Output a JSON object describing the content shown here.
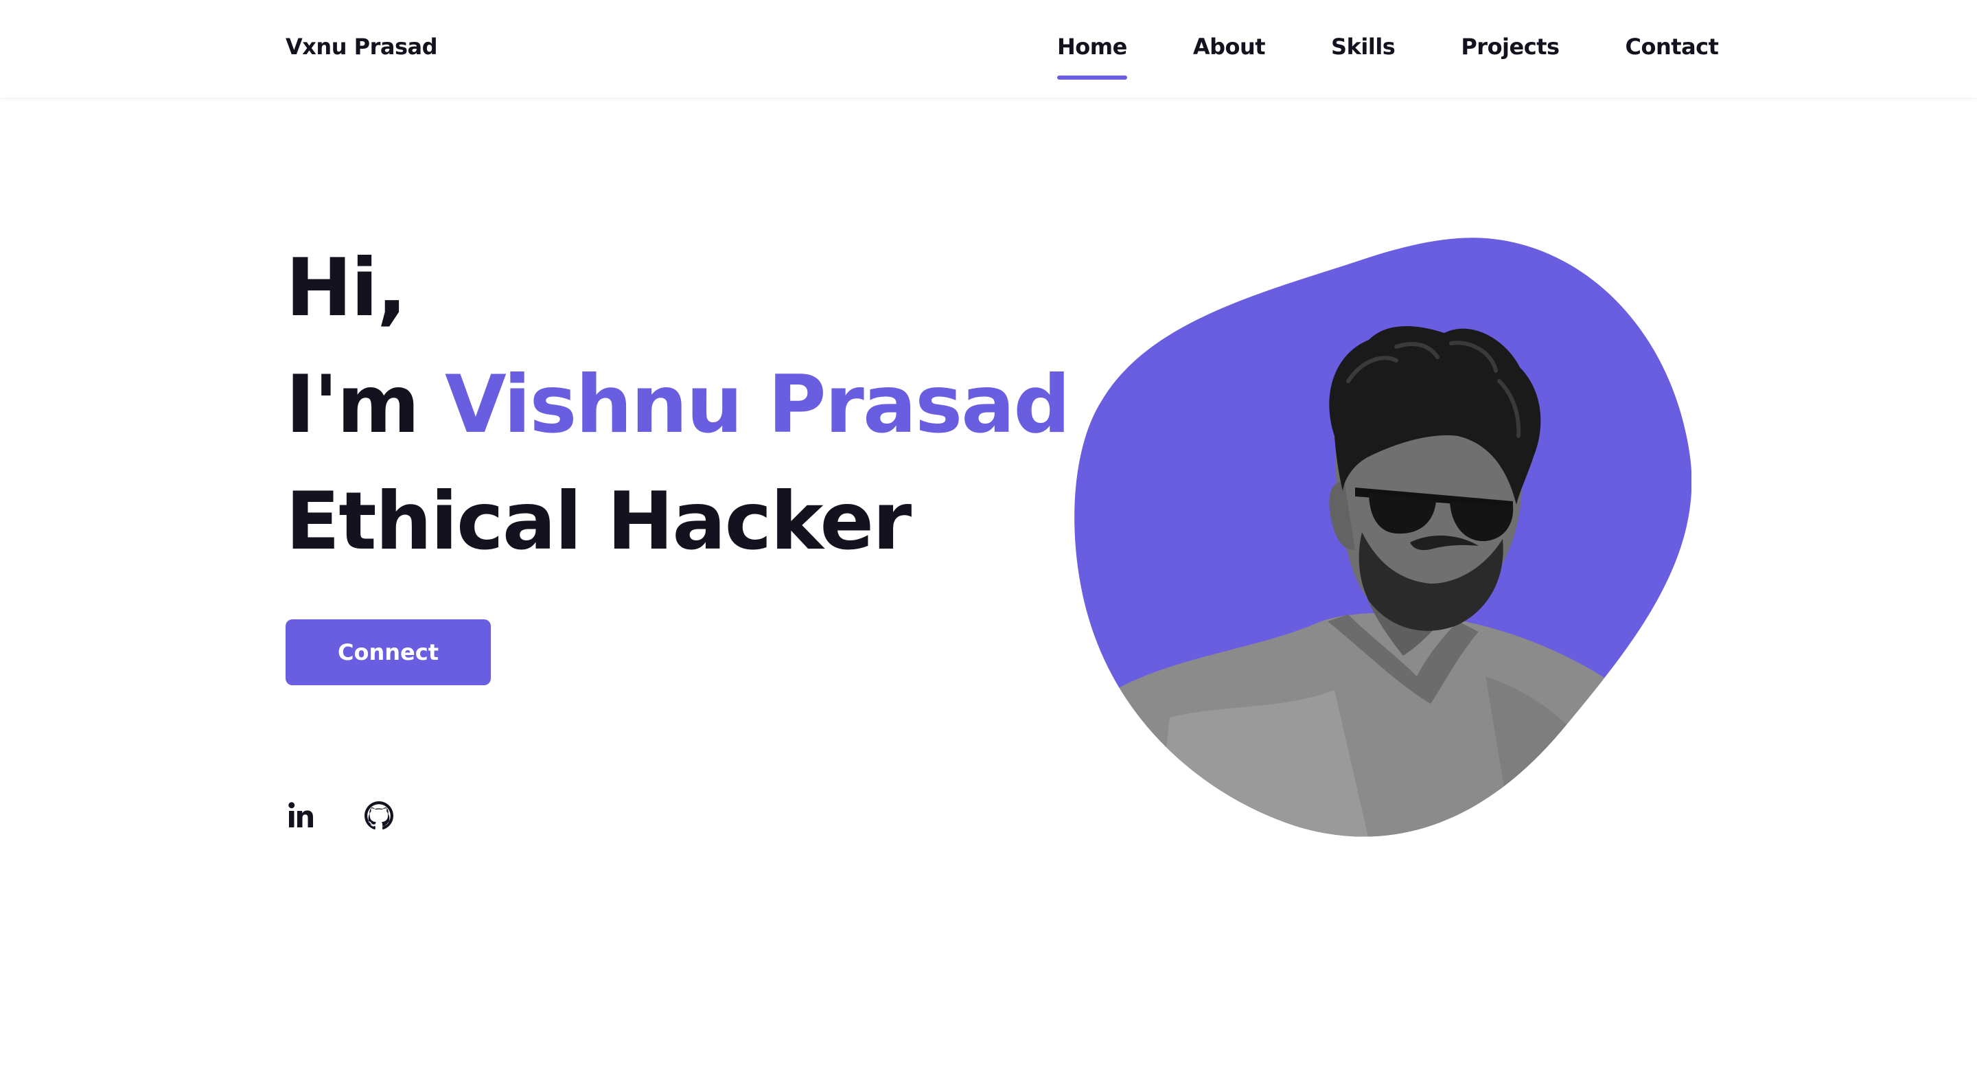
{
  "brand": {
    "name": "Vxnu Prasad",
    "accent_color": "#6a5ee0",
    "text_color": "#14121f"
  },
  "nav": {
    "items": [
      {
        "label": "Home",
        "active": true
      },
      {
        "label": "About",
        "active": false
      },
      {
        "label": "Skills",
        "active": false
      },
      {
        "label": "Projects",
        "active": false
      },
      {
        "label": "Contact",
        "active": false
      }
    ]
  },
  "hero": {
    "greeting": "Hi,",
    "intro_prefix": "I'm",
    "name": "Vishnu Prasad",
    "role": "Ethical Hacker",
    "cta_label": "Connect"
  },
  "socials": [
    {
      "icon": "linkedin-icon"
    },
    {
      "icon": "github-icon"
    }
  ],
  "portrait": {
    "icon": "portrait-illustration",
    "blob_color": "#6a5ee0"
  }
}
